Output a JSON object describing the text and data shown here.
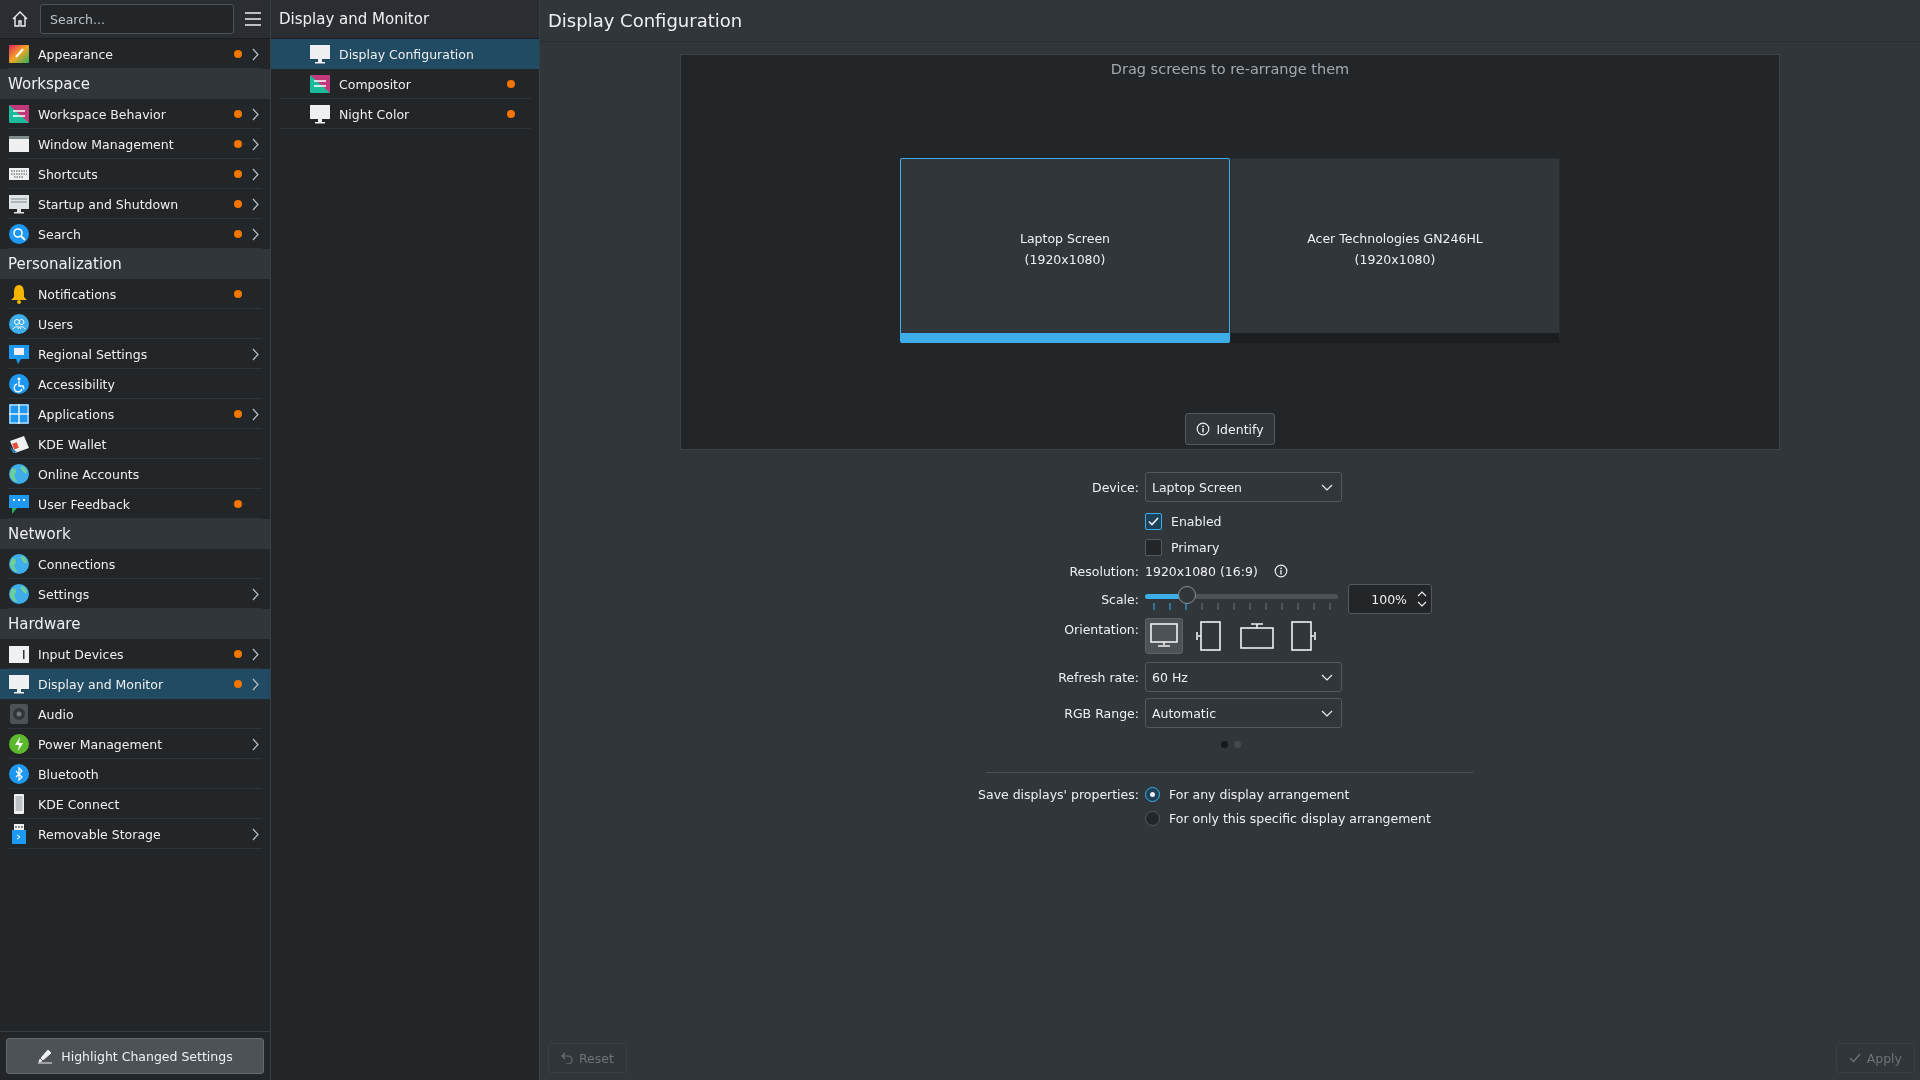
{
  "sidebar": {
    "search": {
      "placeholder": "Search..."
    },
    "items": [
      {
        "kind": "item",
        "label": "Appearance",
        "changed": true,
        "expandable": true,
        "selected": false
      },
      {
        "kind": "header",
        "label": "Workspace"
      },
      {
        "kind": "item",
        "label": "Workspace Behavior",
        "changed": true,
        "expandable": true,
        "selected": false
      },
      {
        "kind": "item",
        "label": "Window Management",
        "changed": true,
        "expandable": true,
        "selected": false
      },
      {
        "kind": "item",
        "label": "Shortcuts",
        "changed": true,
        "expandable": true,
        "selected": false
      },
      {
        "kind": "item",
        "label": "Startup and Shutdown",
        "changed": true,
        "expandable": true,
        "selected": false
      },
      {
        "kind": "item",
        "label": "Search",
        "changed": true,
        "expandable": true,
        "selected": false
      },
      {
        "kind": "header",
        "label": "Personalization"
      },
      {
        "kind": "item",
        "label": "Notifications",
        "changed": true,
        "expandable": false,
        "selected": false
      },
      {
        "kind": "item",
        "label": "Users",
        "changed": false,
        "expandable": false,
        "selected": false
      },
      {
        "kind": "item",
        "label": "Regional Settings",
        "changed": false,
        "expandable": true,
        "selected": false
      },
      {
        "kind": "item",
        "label": "Accessibility",
        "changed": false,
        "expandable": false,
        "selected": false
      },
      {
        "kind": "item",
        "label": "Applications",
        "changed": true,
        "expandable": true,
        "selected": false
      },
      {
        "kind": "item",
        "label": "KDE Wallet",
        "changed": false,
        "expandable": false,
        "selected": false
      },
      {
        "kind": "item",
        "label": "Online Accounts",
        "changed": false,
        "expandable": false,
        "selected": false
      },
      {
        "kind": "item",
        "label": "User Feedback",
        "changed": true,
        "expandable": false,
        "selected": false
      },
      {
        "kind": "header",
        "label": "Network"
      },
      {
        "kind": "item",
        "label": "Connections",
        "changed": false,
        "expandable": false,
        "selected": false
      },
      {
        "kind": "item",
        "label": "Settings",
        "changed": false,
        "expandable": true,
        "selected": false
      },
      {
        "kind": "header",
        "label": "Hardware"
      },
      {
        "kind": "item",
        "label": "Input Devices",
        "changed": true,
        "expandable": true,
        "selected": false
      },
      {
        "kind": "item",
        "label": "Display and Monitor",
        "changed": true,
        "expandable": true,
        "selected": true
      },
      {
        "kind": "item",
        "label": "Audio",
        "changed": false,
        "expandable": false,
        "selected": false
      },
      {
        "kind": "item",
        "label": "Power Management",
        "changed": false,
        "expandable": true,
        "selected": false
      },
      {
        "kind": "item",
        "label": "Bluetooth",
        "changed": false,
        "expandable": false,
        "selected": false
      },
      {
        "kind": "item",
        "label": "KDE Connect",
        "changed": false,
        "expandable": false,
        "selected": false
      },
      {
        "kind": "item",
        "label": "Removable Storage",
        "changed": false,
        "expandable": true,
        "selected": false
      }
    ],
    "highlight_button": "Highlight Changed Settings"
  },
  "subpanel": {
    "title": "Display and Monitor",
    "items": [
      {
        "label": "Display Configuration",
        "changed": false,
        "selected": true
      },
      {
        "label": "Compositor",
        "changed": true,
        "selected": false
      },
      {
        "label": "Night Color",
        "changed": true,
        "selected": false
      }
    ]
  },
  "main": {
    "title": "Display Configuration",
    "arrangement": {
      "hint": "Drag screens to re-arrange them",
      "screens": [
        {
          "name": "Laptop Screen",
          "resolution": "(1920x1080)",
          "selected": true
        },
        {
          "name": "Acer Technologies GN246HL",
          "resolution": "(1920x1080)",
          "selected": false
        }
      ],
      "identify_button": "Identify"
    },
    "form": {
      "device": {
        "label": "Device:",
        "value": "Laptop Screen"
      },
      "checkboxes": [
        {
          "label": "Enabled",
          "checked": true
        },
        {
          "label": "Primary",
          "checked": false
        }
      ],
      "resolution": {
        "label": "Resolution:",
        "value": "1920x1080 (16:9)"
      },
      "scale": {
        "label": "Scale:",
        "level": 0.22,
        "value": "100%"
      },
      "orientation": {
        "label": "Orientation:",
        "options": [
          {
            "selected": true
          },
          {
            "selected": false
          },
          {
            "selected": false
          },
          {
            "selected": false
          }
        ]
      },
      "refresh_rate": {
        "label": "Refresh rate:",
        "value": "60 Hz"
      },
      "rgb_range": {
        "label": "RGB Range:",
        "value": "Automatic"
      },
      "pages": [
        {
          "selected": true
        },
        {
          "selected": false
        }
      ],
      "save": {
        "label": "Save displays' properties:",
        "options": [
          {
            "label": "For any display arrangement",
            "selected": true
          },
          {
            "label": "For only this specific display arrangement",
            "selected": false
          }
        ]
      }
    },
    "footer": {
      "reset": {
        "label": "Reset",
        "disabled": true
      },
      "apply": {
        "label": "Apply",
        "disabled": true
      }
    }
  }
}
